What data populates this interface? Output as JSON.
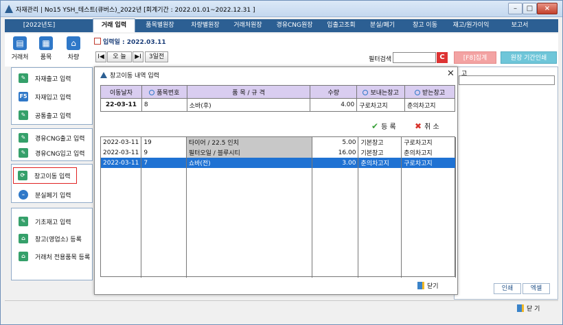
{
  "window": {
    "title": "자재관리 | No15 YSH_테스트(큐버스)_2022년 [회계기간 : 2022.01.01~2022.12.31 ]",
    "min": "–",
    "max": "□",
    "close": "×"
  },
  "menu": [
    {
      "label": "[2022년도]"
    },
    {
      "label": "거래 입력"
    },
    {
      "label": "품목별원장"
    },
    {
      "label": "차량별원장"
    },
    {
      "label": "거래처원장"
    },
    {
      "label": "경유CNG원장"
    },
    {
      "label": "입출고조회"
    },
    {
      "label": "분실/폐기"
    },
    {
      "label": "창고 이동"
    },
    {
      "label": "재고/원가이익"
    },
    {
      "label": "보고서"
    }
  ],
  "toolbar": {
    "items": [
      {
        "label": "거래처",
        "icon": "ledger-icon"
      },
      {
        "label": "품목",
        "icon": "document-icon"
      },
      {
        "label": "차량",
        "icon": "home-icon"
      }
    ],
    "date_label": "입력일 : 2022.03.11",
    "nav": {
      "first": "I◀",
      "today": "오 늘",
      "next": "▶I",
      "three_days": "3일전"
    },
    "filter_label": "필터검색",
    "filter_value": "",
    "refresh": "C",
    "f8": "[F8]집계",
    "print_period": "원장 기간인쇄"
  },
  "sidebar": {
    "groups": [
      [
        {
          "label": "자재출고 입력",
          "icon": "F"
        },
        {
          "label": "자재입고 입력",
          "icon": "F5"
        },
        {
          "label": "공통출고 입력",
          "icon": "✎"
        }
      ],
      [
        {
          "label": "경유CNG출고 입력",
          "icon": "✎"
        },
        {
          "label": "경유CNG입고 입력",
          "icon": "✎"
        }
      ],
      [
        {
          "label": "창고이동 입력",
          "icon": "⟳"
        },
        {
          "label": "분실폐기 입력",
          "icon": "–"
        }
      ],
      [
        {
          "label": "기초재고 입력",
          "icon": "✎"
        },
        {
          "label": "창고(영업소) 등록",
          "icon": "⌂"
        },
        {
          "label": "거래처 전용품목 등록",
          "icon": "⌂"
        }
      ]
    ]
  },
  "right_panel": {
    "header": "고"
  },
  "footer": {
    "print": "인쇄",
    "excel": "엑셀",
    "close": "닫 기"
  },
  "dialog": {
    "title": "창고이동 내역 입력",
    "close": "✕",
    "input_headers": [
      "이동날자",
      "품목번호",
      "품 목 / 규 격",
      "수량",
      "보내는창고",
      "받는창고"
    ],
    "input_row": [
      "22-03-11",
      "8",
      "소바(후)",
      "4.00",
      "구로차고지",
      "춘의차고지"
    ],
    "register": "등 록",
    "cancel": "취 소",
    "rows": [
      [
        "2022-03-11",
        "19",
        "타이어 / 22.5 인치",
        "5.00",
        "기본창고",
        "구로차고지"
      ],
      [
        "2022-03-11",
        "9",
        "필터오일 / 블루시티",
        "16.00",
        "기본창고",
        "춘의차고지"
      ],
      [
        "2022-03-11",
        "7",
        "쇼바(전)",
        "3.00",
        "춘의차고지",
        "구로차고지"
      ]
    ],
    "close_label": "닫기"
  },
  "colors": {
    "menubar": "#2c5f93",
    "selected_row": "#1f72d3",
    "header_purple": "#d9cdf0"
  }
}
